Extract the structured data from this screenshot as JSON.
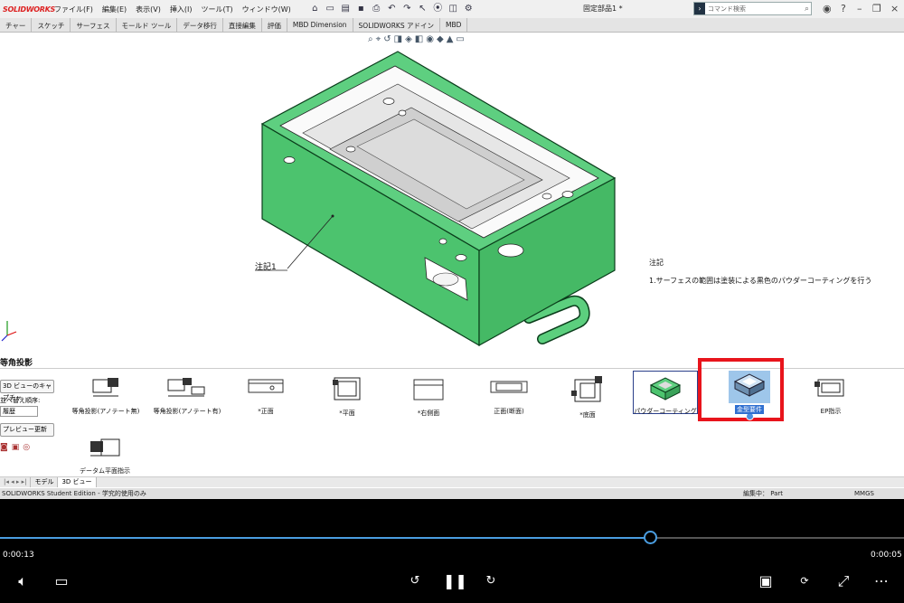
{
  "app": {
    "logo": "SOLIDWORKS",
    "menu": [
      "ファイル(F)",
      "編集(E)",
      "表示(V)",
      "挿入(I)",
      "ツール(T)",
      "ウィンドウ(W)"
    ],
    "doc_title": "固定部品1 *",
    "command_search_placeholder": "コマンド検索"
  },
  "tabs": [
    "チャー",
    "スケッチ",
    "サーフェス",
    "モールド ツール",
    "データ移行",
    "直接編集",
    "評価",
    "MBD Dimension",
    "SOLIDWORKS アドイン",
    "MBD"
  ],
  "viewport": {
    "note_title": "注記",
    "note_text": "1.サーフェスの範囲は塗装による黒色のパウダーコーティングを行う",
    "callout": "注記1",
    "body_color": "#4cc36e"
  },
  "view_palette": {
    "title": "等角投影",
    "capture_button": "3D ビューのキャプチャ",
    "sort_label": "並べ替え順序:",
    "sort_value": "履歴",
    "refresh_button": "プレビュー更新",
    "views": [
      {
        "label": "等角投影(アノテート無)"
      },
      {
        "label": "等角投影(アノテート有)"
      },
      {
        "label": "*正面"
      },
      {
        "label": "*平面"
      },
      {
        "label": "*右側面"
      },
      {
        "label": "正面(断面)"
      },
      {
        "label": "*底面"
      },
      {
        "label": "パウダーコーティング"
      },
      {
        "label": "金型要件"
      },
      {
        "label": "EP指示"
      },
      {
        "label": "データム平面指示"
      }
    ],
    "highlight_color": "#e8141c"
  },
  "bottom_tabs": [
    "モデル",
    "3D ビュー"
  ],
  "status": {
    "left": "SOLIDWORKS Student Edition - 学究的使用のみ",
    "editing": "編集中： Part",
    "units": "MMGS"
  },
  "player": {
    "elapsed": "0:00:13",
    "remaining": "0:00:05",
    "progress": 0.72,
    "accent": "#4a9de0"
  }
}
